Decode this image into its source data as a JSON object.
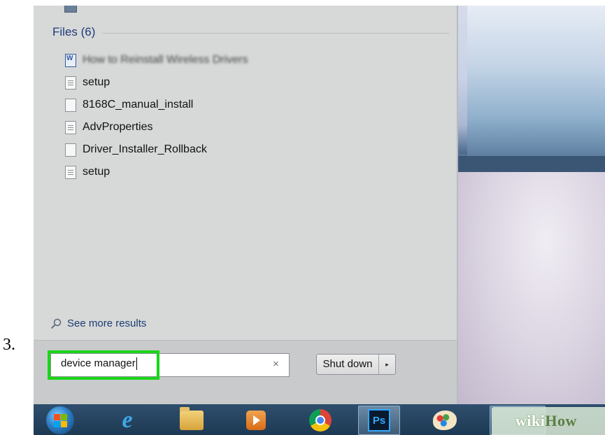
{
  "step": {
    "number": "3."
  },
  "start_menu": {
    "files_header": "Files (6)",
    "files": [
      {
        "label": "How to Reinstall Wireless Drivers",
        "icon": "word-document-icon",
        "blurred": true
      },
      {
        "label": "setup",
        "icon": "settings-file-icon"
      },
      {
        "label": "8168C_manual_install",
        "icon": "blank-file-icon"
      },
      {
        "label": "AdvProperties",
        "icon": "settings-file-icon"
      },
      {
        "label": "Driver_Installer_Rollback",
        "icon": "blank-file-icon"
      },
      {
        "label": "setup",
        "icon": "settings-file-icon"
      }
    ],
    "see_more": "See more results",
    "search": {
      "value": "device manager",
      "clear_symbol": "×"
    },
    "shutdown": {
      "label": "Shut down",
      "arrow": "▸"
    }
  },
  "taskbar": {
    "items": [
      "start-orb-icon",
      "internet-explorer-icon",
      "file-explorer-icon",
      "media-player-icon",
      "chrome-icon",
      "photoshop-icon",
      "paint-icon"
    ],
    "photoshop_label": "Ps"
  },
  "watermark": {
    "wiki": "wiki",
    "how": "How"
  },
  "colors": {
    "highlight": "#19d619",
    "panel": "#d7d8d8",
    "taskbar": "#1d3953"
  }
}
